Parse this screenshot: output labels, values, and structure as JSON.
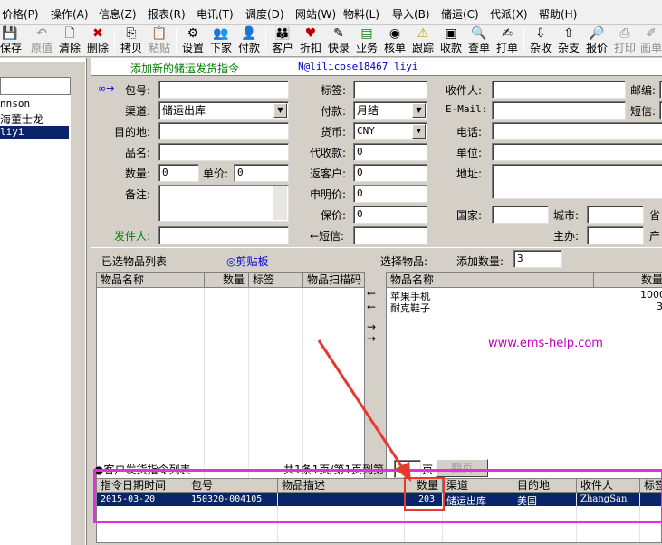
{
  "menu": [
    "价格(P)",
    "操作(A)",
    "信息(Z)",
    "报表(R)",
    "电讯(T)",
    "调度(D)",
    "网站(W)",
    "物料(L)",
    "导入(B)",
    "储运(C)",
    "代派(X)",
    "帮助(H)"
  ],
  "toolbar": [
    "保存",
    "原值",
    "清除",
    "删除",
    "拷贝",
    "粘贴",
    "设置",
    "下家",
    "付款",
    "客户",
    "折扣",
    "快录",
    "业务",
    "核单",
    "跟踪",
    "收款",
    "查单",
    "打单",
    "杂收",
    "杂支",
    "报价",
    "打印",
    "画单"
  ],
  "left_panel": {
    "items": [
      "nnson",
      "海董士龙",
      "liyi"
    ],
    "selected_index": 2
  },
  "header": {
    "title": "添加新的储运发货指令",
    "user": "N@lilicose18467 liyi"
  },
  "form": {
    "arrow_glyph": "∞→",
    "col1": {
      "parcel_label": "包号:",
      "parcel_value": "",
      "channel_label": "渠道:",
      "channel_value": "储运出库",
      "dest_label": "目的地:",
      "dest_value": "",
      "product_label": "品名:",
      "product_value": "",
      "qty_label": "数量:",
      "qty_value": "0",
      "price_label": "单价:",
      "price_value": "0",
      "note_label": "备注:",
      "note_value": "",
      "sender_label": "发件人:",
      "sender_value": ""
    },
    "col2": {
      "tag_label": "标签:",
      "tag_value": "",
      "pay_label": "付款:",
      "pay_value": "月结",
      "currency_label": "货币:",
      "currency_value": "CNY",
      "cod_label": "代收款:",
      "cod_value": "0",
      "rebate_label": "返客户:",
      "rebate_value": "0",
      "declared_label": "申明价:",
      "declared_value": "0",
      "insured_label": "保价:",
      "insured_value": "0",
      "sms_label": "←短信:",
      "sms_value": ""
    },
    "col3": {
      "recipient_label": "收件人:",
      "email_label": "E-Mail:",
      "phone_label": "电话:",
      "unit_label": "单位:",
      "address_label": "地址:",
      "country_label": "国家:",
      "city_label": "城市:",
      "host_label": "主办:",
      "postcode_label": "邮编:",
      "sms2_label": "短信:",
      "province_label": "省",
      "origin_label": "产"
    }
  },
  "selected_items": {
    "title": "已选物品列表",
    "clipboard": "◎剪贴板",
    "columns": [
      "物品名称",
      "数量",
      "标签",
      "物品扫描码"
    ]
  },
  "choose_items": {
    "title": "选择物品:",
    "add_qty_label": "添加数量:",
    "add_qty_value": "3",
    "columns": [
      "物品名称",
      "数量"
    ],
    "rows": [
      {
        "name": "苹果手机",
        "qty": "1000"
      },
      {
        "name": "耐克鞋子",
        "qty": "3"
      }
    ]
  },
  "transfer_arrows": [
    "←",
    "←",
    "→",
    "→"
  ],
  "watermark": "www.ems-help.com",
  "orders": {
    "title": "●客户发货指令列表",
    "paging_text": "共1条1页/第1页到第",
    "page_value": "1",
    "page_unit": "页",
    "go_button": "翻页",
    "columns": [
      "指令日期时间",
      "包号",
      "物品描述",
      "数量",
      "渠道",
      "目的地",
      "收件人",
      "标签"
    ],
    "rows": [
      {
        "date": "2015-03-20",
        "parcel": "150320-004105",
        "desc": "",
        "qty": "203",
        "channel": "储运出库",
        "dest": "美国",
        "recipient": "ZhangSan",
        "tag": ""
      }
    ]
  },
  "colors": {
    "title_green": "#008000",
    "link_blue": "#0000c8",
    "selection_navy": "#0a246a",
    "highlight_magenta": "#e030e0",
    "callout_red": "#e8392f",
    "watermark": "#c000c0"
  }
}
